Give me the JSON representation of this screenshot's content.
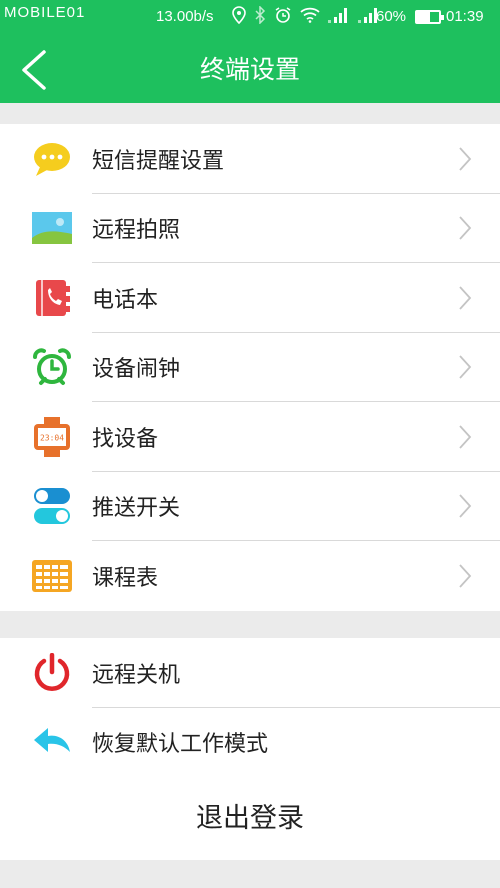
{
  "status_bar": {
    "watermark": "MOBILE01",
    "network_rate": "13.00b/s",
    "battery_percent": "60%",
    "battery_level": 0.6,
    "time": "01:39",
    "icons": [
      "location-icon",
      "bluetooth-icon",
      "alarm-icon",
      "wifi-icon",
      "signal-icon",
      "signal-icon",
      "battery-icon"
    ]
  },
  "header": {
    "title": "终端设置",
    "back_icon": "chevron-left-icon",
    "color": "#1ec05e"
  },
  "group1": [
    {
      "label": "短信提醒设置",
      "icon": "message-bubble-icon"
    },
    {
      "label": "远程拍照",
      "icon": "picture-icon"
    },
    {
      "label": "电话本",
      "icon": "phonebook-icon"
    },
    {
      "label": "设备闹钟",
      "icon": "alarm-clock-icon"
    },
    {
      "label": "找设备",
      "icon": "watch-icon",
      "icon_text": "23:04"
    },
    {
      "label": "推送开关",
      "icon": "toggle-switches-icon"
    },
    {
      "label": "课程表",
      "icon": "timetable-icon"
    }
  ],
  "group2": [
    {
      "label": "远程关机",
      "icon": "power-icon"
    },
    {
      "label": "恢复默认工作模式",
      "icon": "undo-arrow-icon"
    }
  ],
  "logout_label": "退出登录"
}
